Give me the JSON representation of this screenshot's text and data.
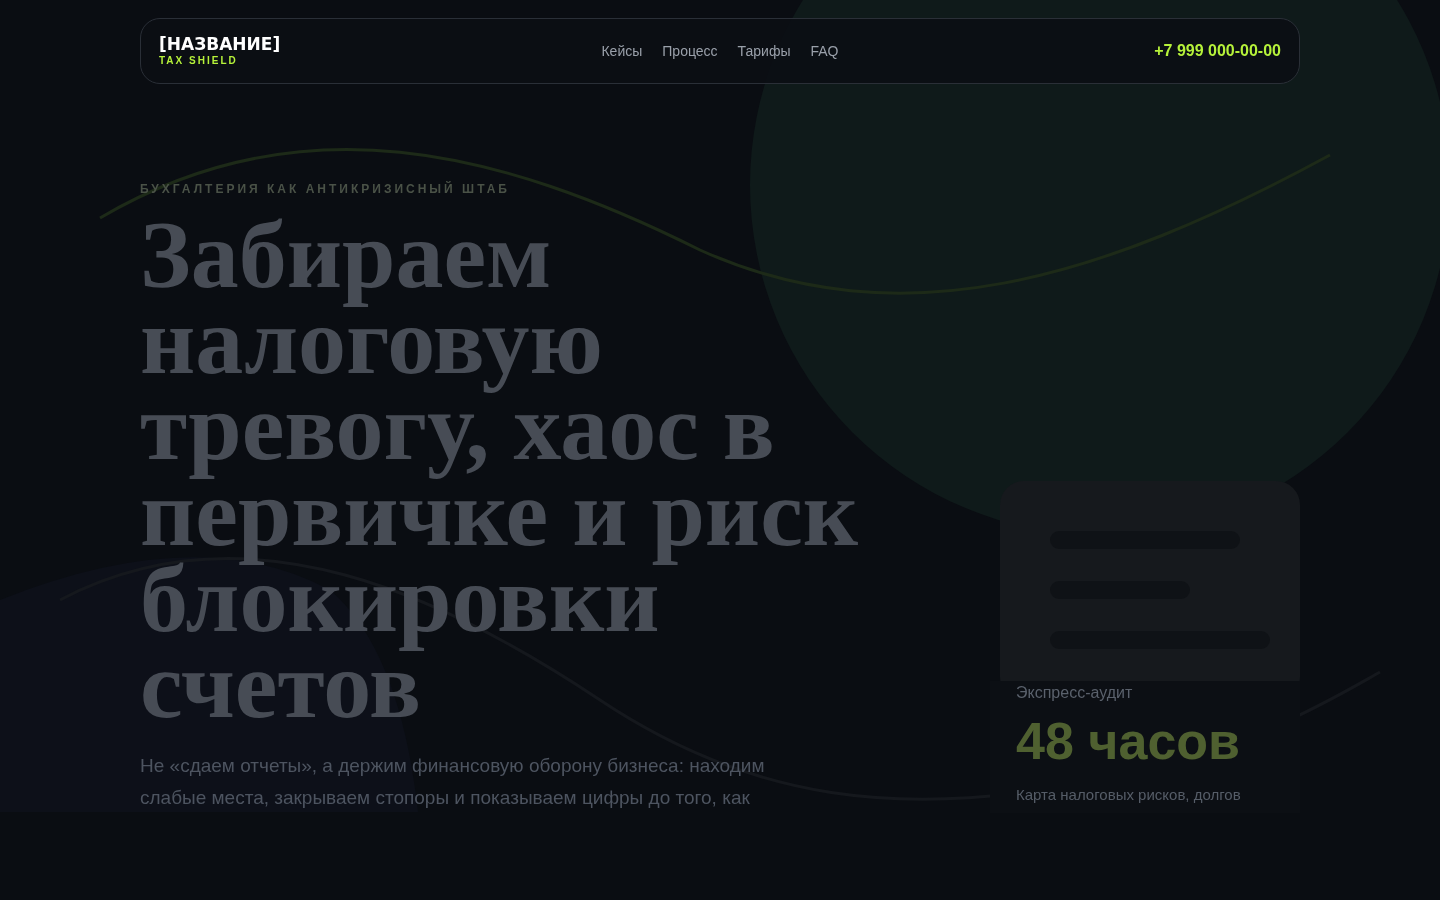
{
  "header": {
    "logo": "[НАЗВАНИЕ]",
    "tagline": "TAX SHIELD",
    "nav": [
      {
        "label": "Кейсы"
      },
      {
        "label": "Процесс"
      },
      {
        "label": "Тарифы"
      },
      {
        "label": "FAQ"
      }
    ],
    "phone": "+7 999 000-00-00"
  },
  "hero": {
    "eyebrow": "БУХГАЛТЕРИЯ КАК АНТИКРИЗИСНЫЙ ШТАБ",
    "title": "Забираем налоговую тревогу, хаос в первичке и риск блокировки счетов",
    "lead": "Не «сдаем отчеты», а держим финансовую оборону бизнеса: находим слабые места, закрываем стопоры и показываем цифры до того, как"
  },
  "stat": {
    "label": "Экспресс-аудит",
    "value": "48 часов",
    "note": "Карта налоговых рисков, долгов"
  }
}
